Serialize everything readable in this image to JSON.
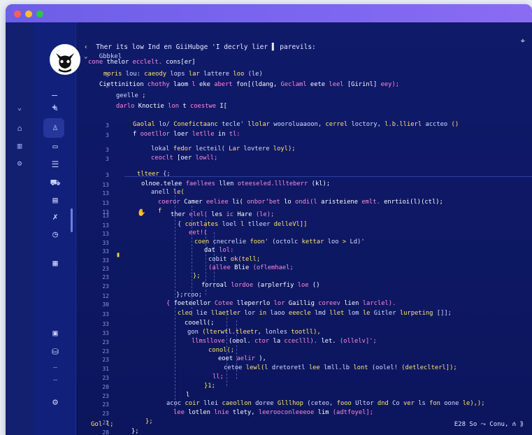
{
  "app": {
    "title": ""
  },
  "editor": {
    "tab_label": "Ther its low Ind en GiiHubge 'I decrly lier  ▌ parevils:",
    "root_node": "Gbbkel",
    "pin_icon": "pin-icon",
    "lines": [
      {
        "n": "",
        "text": "cone thelor ecclelt. cons[er]"
      },
      {
        "n": "3",
        "text": "moris lou: caeody lops lar lattere loo (le)"
      },
      {
        "n": "2",
        "text": "Ciettinition chothy laom l eke abert fon[(ldang, Geclaml eete leel [Girinl] eey);"
      },
      {
        "n": "",
        "text": "geelle ;"
      },
      {
        "n": "",
        "text": "darlo Knoctie lon t coestwe I["
      },
      {
        "n": "3",
        "text": "Gaolal lo/ Conefictaanc tecle' llolar wooroluaaoon, cerrel loctory, l.b.llierl accteo ()"
      },
      {
        "n": "3",
        "text": "f ooetllor loer letlle in tl:"
      },
      {
        "n": "3",
        "text": "lokal fedor lecteil( Lar lovtere loyl);"
      },
      {
        "n": "3",
        "text": "ceoclt [oer lowll;"
      },
      {
        "n": "3",
        "text": "tlteer {;"
      },
      {
        "n": "13",
        "text": "olnoe.telee faellees llen oteeseled.lllteberr (kl);"
      },
      {
        "n": "13",
        "text": "anell le("
      },
      {
        "n": "13",
        "text": "coeror Camer eeliee li( onborʼbet lo ondi(l aristeiene emlt. enrtioi(l)(ctl);"
      },
      {
        "n": "13",
        "text": "f"
      },
      {
        "n": "13",
        "text": "ther elel( les ic Hare (le);"
      },
      {
        "n": "13",
        "text": "{ contlates loel l tlleer delleVl]]"
      },
      {
        "n": "13",
        "text": "eet!("
      },
      {
        "n": "33",
        "text": "coen cnecrelie foon' (octolc kettar loo > Ld)'"
      },
      {
        "n": "33",
        "text": "dat lol:"
      },
      {
        "n": "33",
        "text": "cobit ok(tell;"
      },
      {
        "n": "23",
        "text": "(allee Blie (oflemhael;"
      },
      {
        "n": "23",
        "text": "};"
      },
      {
        "n": "23",
        "text": "forroal lordoe (arplerfiy loe ()"
      },
      {
        "n": "12",
        "text": "};rcoo;"
      },
      {
        "n": "30",
        "text": "{ foeteellor Cotee lleperrlo lor Gaillig coreev lien larclel)."
      },
      {
        "n": "33",
        "text": "cleo lie llaetler lor in laoo eeecle lmd llet lom le Gitler lurpeting []];"
      },
      {
        "n": "33",
        "text": "cooell(;"
      },
      {
        "n": "33",
        "text": "gon (lterwtl.tleetr, lonles tootll),"
      },
      {
        "n": "23",
        "text": "llmsllove (oeol. ctor la cceclll). let. (ollelv]';"
      },
      {
        "n": "23",
        "text": "conol(;"
      },
      {
        "n": "23",
        "text": "eoet aelir ),"
      },
      {
        "n": "31",
        "text": "cetoe lewl(l dretoretl lee lmll.lb lont (oolel! (detleclterl]);"
      },
      {
        "n": "23",
        "text": "ll;"
      },
      {
        "n": "20",
        "text": "}1;"
      },
      {
        "n": "23",
        "text": "l"
      },
      {
        "n": "23",
        "text": "acoc coir llei caeollon doree Glllhop (ceteo, fooo Ultor dnd Co ver ls fon oone le),);"
      },
      {
        "n": "23",
        "text": "lee lotlen lnie tlety, leerooconleeeoe lim (adtfoyel];"
      },
      {
        "n": "22",
        "text": "};"
      },
      {
        "n": "28",
        "text": "};"
      }
    ]
  },
  "statusbar": {
    "left": "Gol l;",
    "right": "E28 So  ⤳  Conu,  ⋔  ⟫"
  }
}
